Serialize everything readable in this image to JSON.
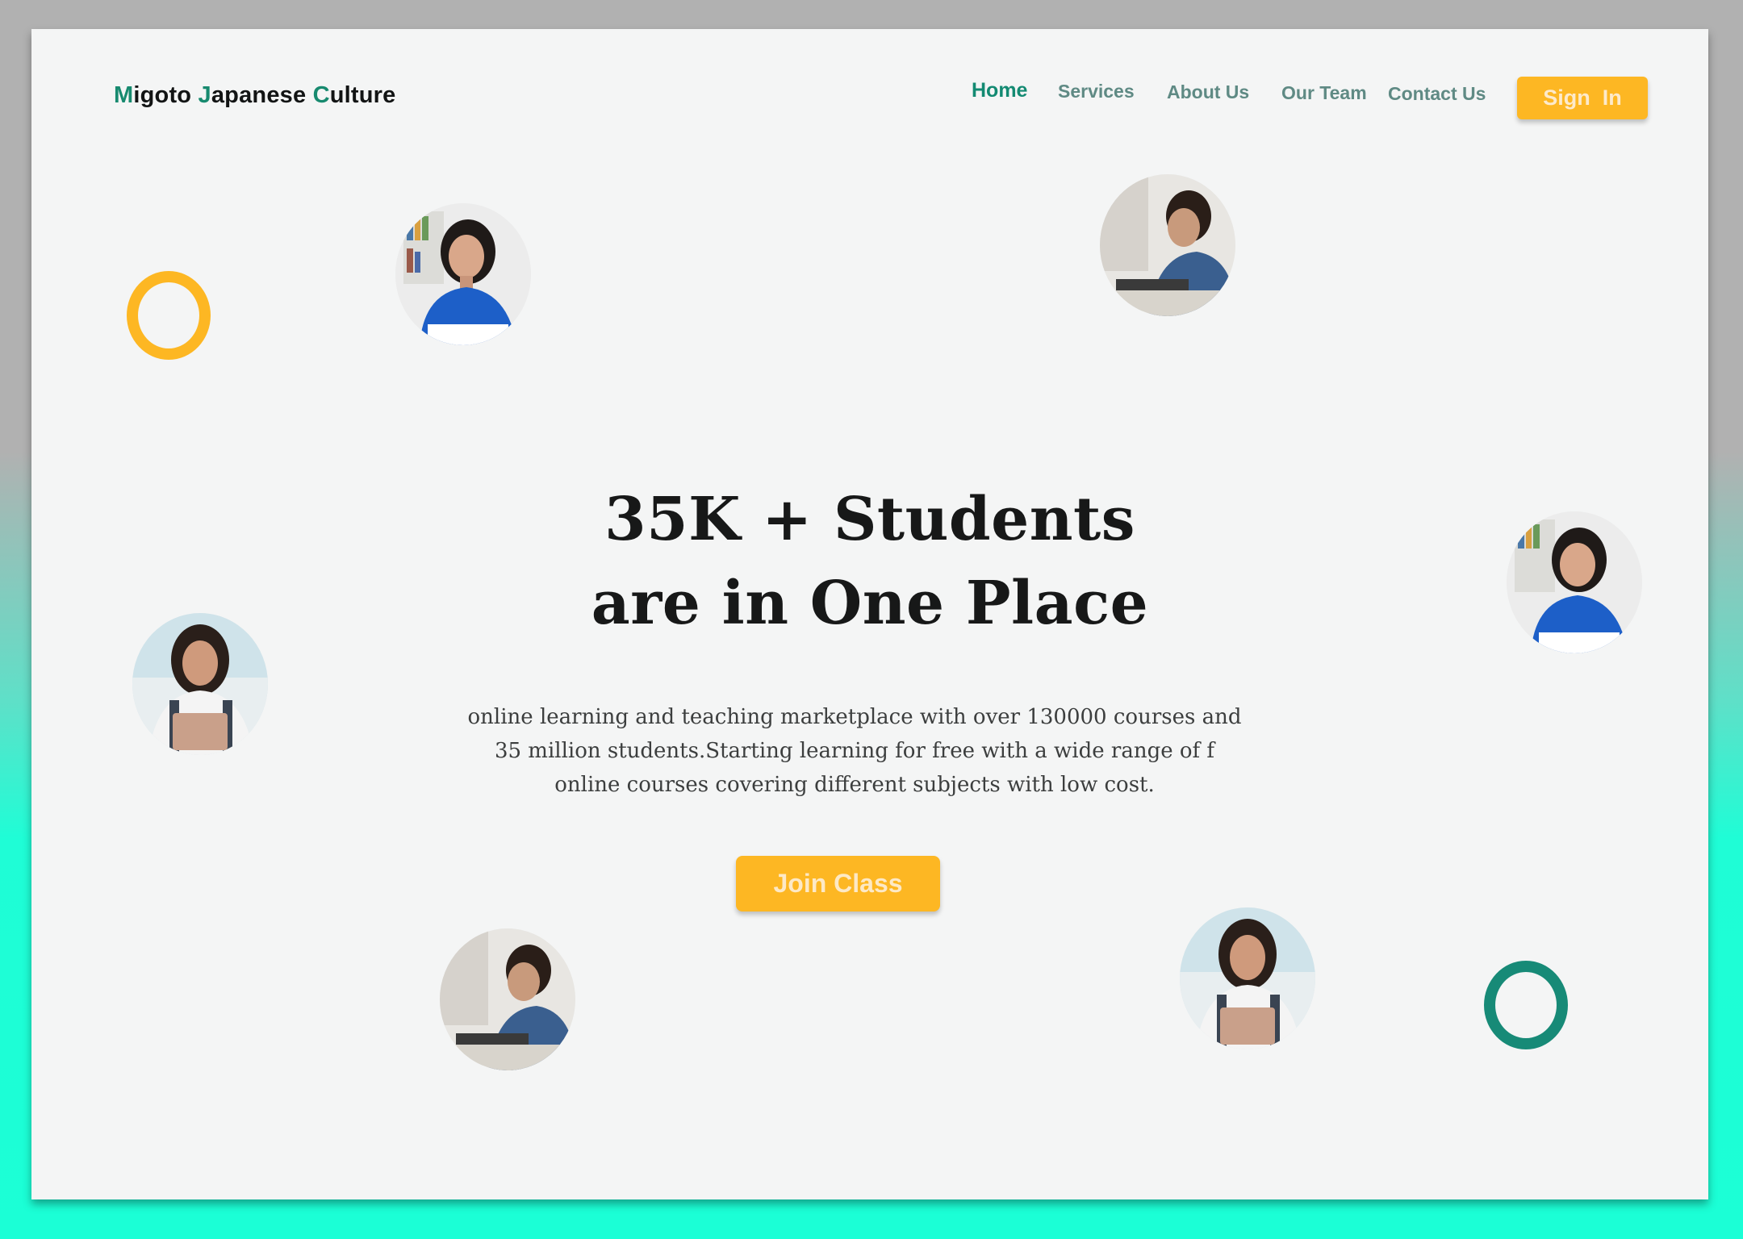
{
  "header": {
    "logo": {
      "part1_acc": "M",
      "part1": "igoto ",
      "part2_acc": "J",
      "part2": "apanese ",
      "part3_acc": "C",
      "part3": "ulture"
    },
    "nav": [
      "Home",
      "Services",
      "About Us",
      "Our Team",
      "Contact Us"
    ],
    "active_nav": "Home",
    "signin_label": "Sign  In"
  },
  "hero": {
    "title_line1": "35K + Students",
    "title_line2": "are in One Place",
    "description": "online learning and teaching marketplace with over 130000 courses and 35 million students.Starting learning for free with a wide range of f online courses covering different subjects with low cost.",
    "cta_label": "Join Class"
  },
  "images": [
    "student-girl-blue-shirt-photo",
    "student-boy-laptop-photo",
    "student-girl-blue-shirt-photo",
    "student-girl-folder-photo",
    "student-boy-laptop-photo",
    "student-girl-folder-photo"
  ],
  "colors": {
    "accent_yellow": "#fdb723",
    "accent_teal": "#178a77",
    "page_bg": "#f4f5f5",
    "nav_text": "#5f8a84",
    "active_nav": "#138a72"
  }
}
